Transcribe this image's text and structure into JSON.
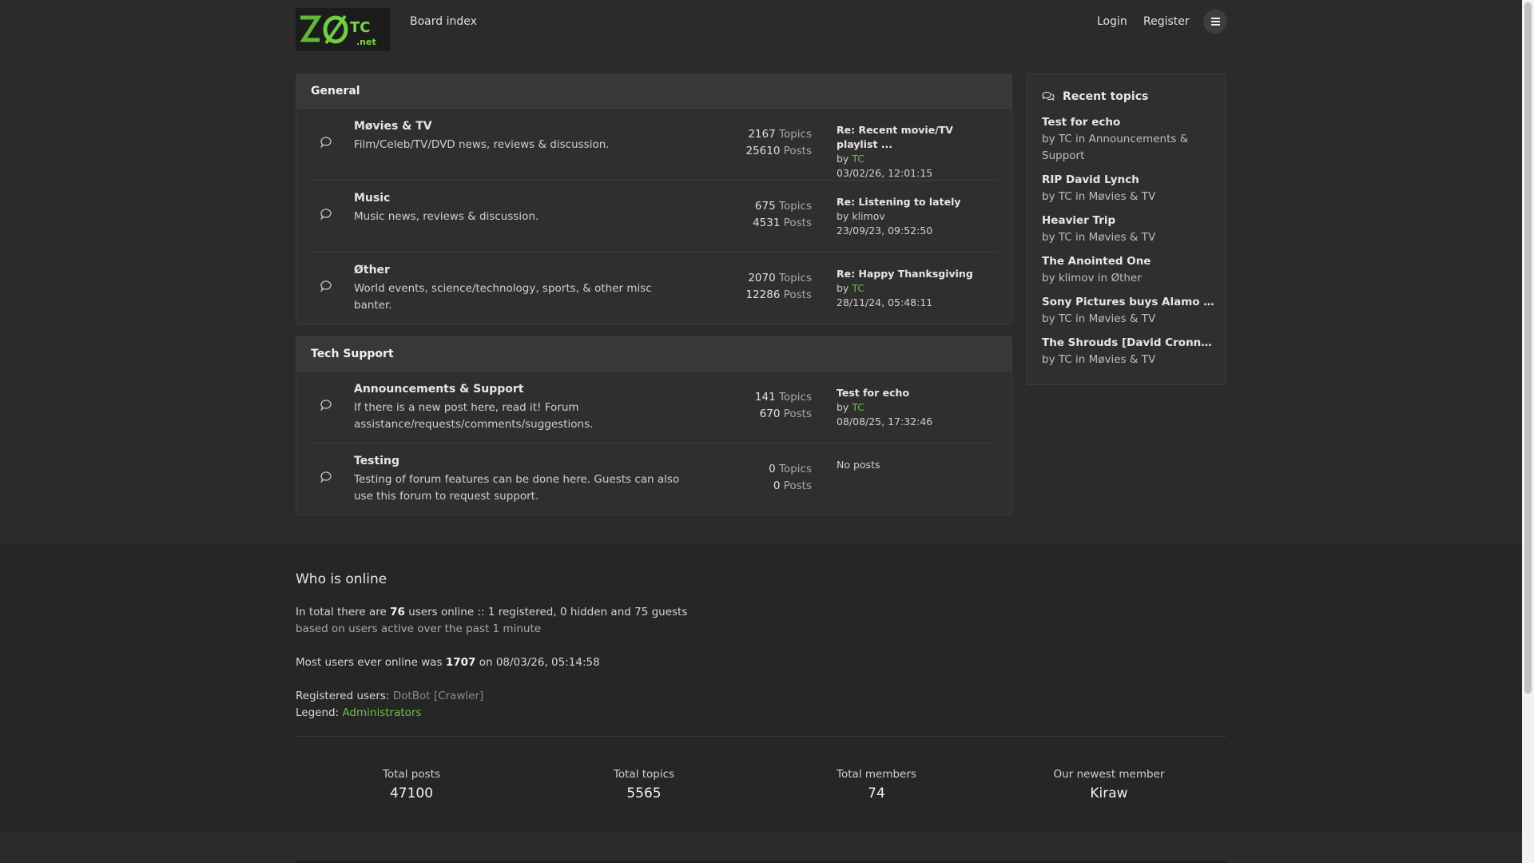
{
  "header": {
    "logo_text": "ZØTC.net",
    "board_index": "Board index",
    "login": "Login",
    "register": "Register"
  },
  "categories": [
    {
      "name": "General",
      "forums": [
        {
          "title": "Møvies & TV",
          "desc": "Film/Celeb/TV/DVD news, reviews & discussion.",
          "topics": "2167",
          "posts": "25610",
          "last_title": "Re: Recent movie/TV playlist ...",
          "last_user": "TC",
          "last_user_green": true,
          "last_date": "03/02/26, 12:01:15"
        },
        {
          "title": "Music",
          "desc": "Music news, reviews & discussion.",
          "topics": "675",
          "posts": "4531",
          "last_title": "Re: Listening to lately",
          "last_user": "klimov",
          "last_user_green": false,
          "last_date": "23/09/23, 09:52:50"
        },
        {
          "title": "Øther",
          "desc": "World events, science/technology, sports, & other misc banter.",
          "topics": "2070",
          "posts": "12286",
          "last_title": "Re: Happy Thanksgiving",
          "last_user": "TC",
          "last_user_green": true,
          "last_date": "28/11/24, 05:48:11"
        }
      ]
    },
    {
      "name": "Tech Support",
      "forums": [
        {
          "title": "Announcements & Support",
          "desc": "If there is a new post here, read it! Forum assistance/requests/comments/suggestions.",
          "topics": "141",
          "posts": "670",
          "last_title": "Test for echo",
          "last_user": "TC",
          "last_user_green": true,
          "last_date": "08/08/25, 17:32:46"
        },
        {
          "title": "Testing",
          "desc": "Testing of forum features can be done here. Guests can also use this forum to request support.",
          "topics": "0",
          "posts": "0",
          "no_posts": "No posts"
        }
      ]
    }
  ],
  "labels": {
    "topics": "Topics",
    "posts": "Posts",
    "by": "by"
  },
  "recent": {
    "title": "Recent topics",
    "items": [
      {
        "title": "Test for echo",
        "meta": "by TC in Announcements & Support"
      },
      {
        "title": "RIP David Lynch",
        "meta": "by TC in Møvies & TV"
      },
      {
        "title": "Heavier Trip",
        "meta": "by TC in Møvies & TV"
      },
      {
        "title": "The Anointed One",
        "meta": "by klimov in Øther"
      },
      {
        "title": "Sony Pictures buys Alamo Draft ...",
        "meta": "by TC in Møvies & TV"
      },
      {
        "title": "The Shrouds [David Cronnenberg]",
        "meta": "by TC in Møvies & TV"
      }
    ]
  },
  "online": {
    "title": "Who is online",
    "line1_pre": "In total there are ",
    "line1_num": "76",
    "line1_post": " users online :: 1 registered, 0 hidden and 75 guests",
    "line2": "based on users active over the past 1 minute",
    "line3_pre": "Most users ever online was ",
    "line3_num": "1707",
    "line3_post": " on 08/03/26, 05:14:58",
    "reg_label": "Registered users: ",
    "reg_users": "DotBot [Crawler]",
    "legend_label": "Legend: ",
    "legend_admins": "Administrators"
  },
  "stats": [
    {
      "label": "Total posts",
      "value": "47100"
    },
    {
      "label": "Total topics",
      "value": "5565"
    },
    {
      "label": "Total members",
      "value": "74"
    },
    {
      "label": "Our newest member",
      "value": "Kiraw"
    }
  ],
  "colors": {
    "accent_green": "#6fbf4a",
    "background": "#2b2b2b",
    "panel": "#2f2f2f"
  }
}
